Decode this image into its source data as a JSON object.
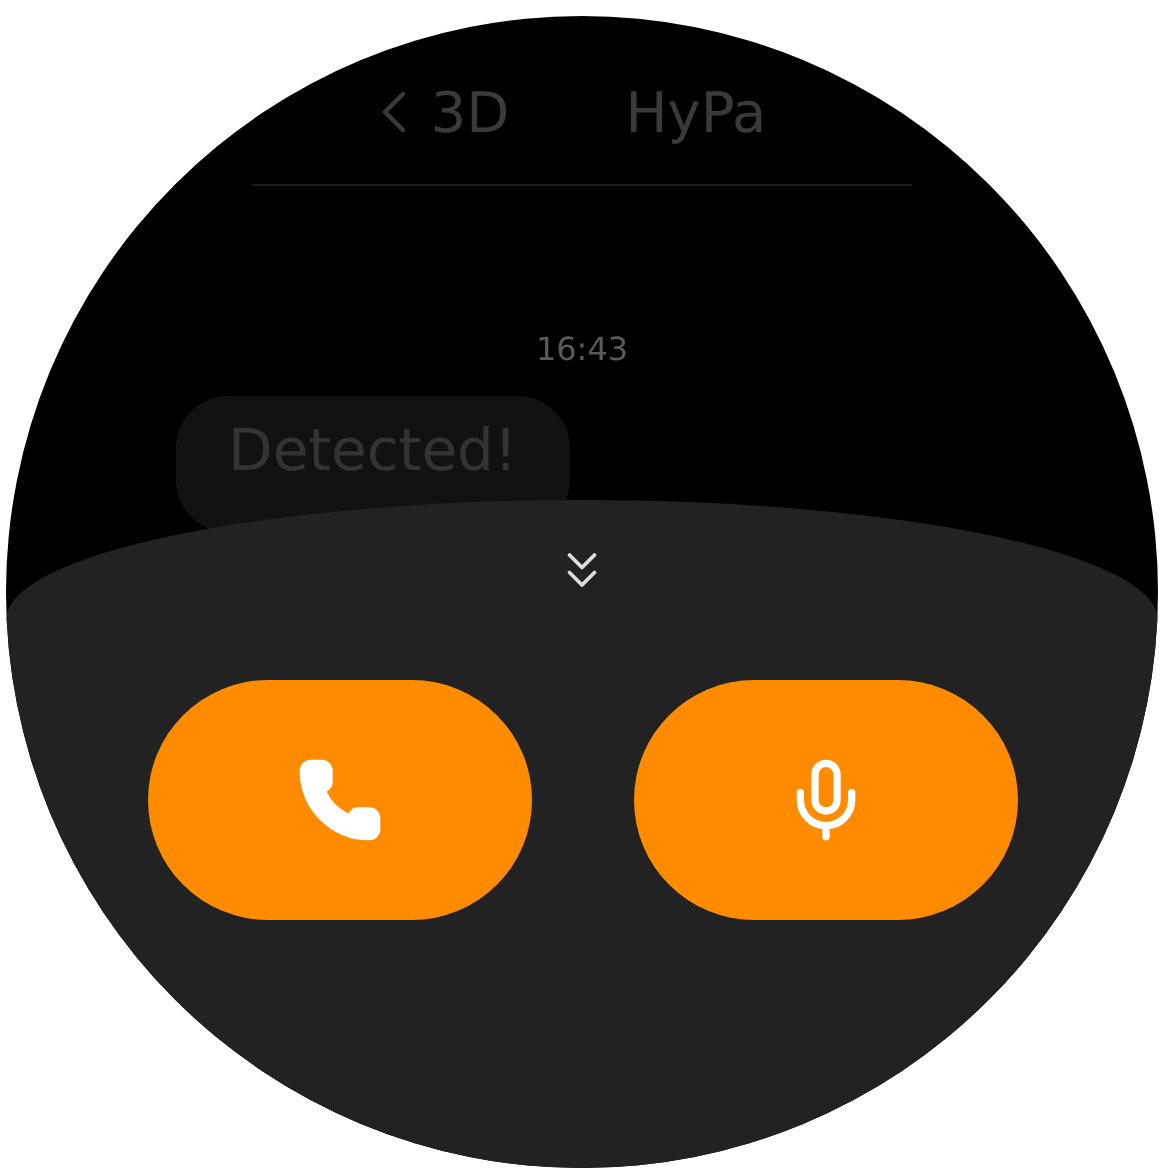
{
  "header": {
    "back_label": "3D",
    "title": "HyPa"
  },
  "time": "16:43",
  "messages": [
    {
      "text": "Detected!"
    }
  ],
  "actions": [
    {
      "kind": "call"
    },
    {
      "kind": "voice"
    }
  ]
}
